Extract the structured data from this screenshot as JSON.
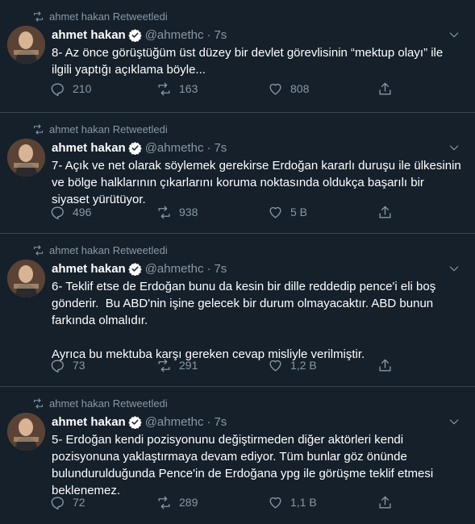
{
  "colors": {
    "background": "#15202b",
    "divider": "#38444d",
    "muted_text": "#8899a6",
    "primary_text": "#ffffff",
    "verified_badge": "#ffffff"
  },
  "tweets": [
    {
      "retweet_label": "ahmet hakan Retweetledi",
      "author_name": "ahmet hakan",
      "handle": "@ahmethc",
      "dot": "·",
      "time": "7s",
      "text": "8- Az önce görüştüğüm üst düzey bir devlet görevlisinin “mektup olayı” ile\nilgili yaptığı açıklama böyle...",
      "reply_count": "210",
      "retweet_count": "163",
      "like_count": "808"
    },
    {
      "retweet_label": "ahmet hakan Retweetledi",
      "author_name": "ahmet hakan",
      "handle": "@ahmethc",
      "dot": "·",
      "time": "7s",
      "text": "7- Açık ve net olarak söylemek gerekirse Erdoğan kararlı duruşu ile ülkesinin\nve bölge halklarının çıkarlarını koruma noktasında oldukça başarılı bir\nsiyaset yürütüyor.",
      "reply_count": "496",
      "retweet_count": "938",
      "like_count": "5 B"
    },
    {
      "retweet_label": "ahmet hakan Retweetledi",
      "author_name": "ahmet hakan",
      "handle": "@ahmethc",
      "dot": "·",
      "time": "7s",
      "text": "6- Teklif etse de Erdoğan bunu da kesin bir dille reddedip pence'i eli boş\ngönderir.  Bu ABD'nin işine gelecek bir durum olmayacaktır. ABD bunun\nfarkında olmalıdır.\n\nAyrıca bu mektuba karşı gereken cevap misliyle verilmiştir.",
      "reply_count": "73",
      "retweet_count": "291",
      "like_count": "1,2 B"
    },
    {
      "retweet_label": "ahmet hakan Retweetledi",
      "author_name": "ahmet hakan",
      "handle": "@ahmethc",
      "dot": "·",
      "time": "7s",
      "text": "5- Erdoğan kendi pozisyonunu değiştirmeden diğer aktörleri kendi\npozisyonuna yaklaştırmaya devam ediyor. Tüm bunlar göz önünde\nbulundurulduğunda Pence'in de Erdoğana ypg ile görüşme teklif etmesi\nbeklenemez.",
      "reply_count": "72",
      "retweet_count": "289",
      "like_count": "1,1 B"
    }
  ]
}
